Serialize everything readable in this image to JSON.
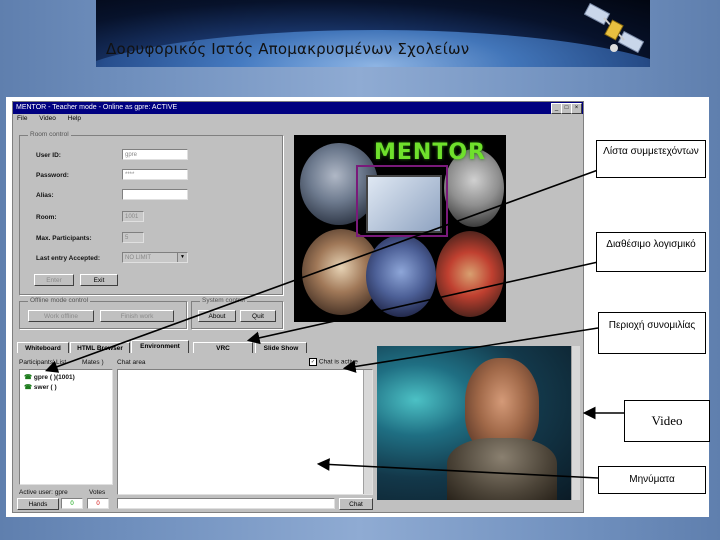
{
  "banner": {
    "title": "Δορυφορικός Ιστός Απομακρυσμένων Σχολείων"
  },
  "window": {
    "title": "MENTOR - Teacher mode - Online as gpre: ACTIVE",
    "buttons": [
      "_",
      "□",
      "×"
    ]
  },
  "menu": [
    "File",
    "Video",
    "Help"
  ],
  "room_control": {
    "group_label": "Room control",
    "fields": [
      {
        "label": "User ID:",
        "value": "gpre"
      },
      {
        "label": "Password:",
        "value": "****"
      },
      {
        "label": "Alias:",
        "value": ""
      },
      {
        "label": "Room:",
        "value": "1001"
      },
      {
        "label": "Max. Participants:",
        "value": "5"
      },
      {
        "label": "Last entry Accepted:",
        "value": "NO LIMIT"
      }
    ],
    "enter_label": "Enter",
    "exit_label": "Exit"
  },
  "offline": {
    "group_label": "Offline mode control",
    "work_offline_label": "Work offline",
    "finish_label": "Finish work"
  },
  "system": {
    "group_label": "System control",
    "about_label": "About",
    "quit_label": "Quit"
  },
  "mentor_image": {
    "logo_text": "MENTOR"
  },
  "tabs": [
    "Whiteboard",
    "HTML Browser",
    "Environment",
    "VRC",
    "Slide Show"
  ],
  "participants": {
    "header": "Participants' List",
    "header_suffix": "Mates )",
    "items": [
      "gpre ( )(1001)",
      "swer ( )"
    ],
    "active_user": "Active user: gpre",
    "votes_label": "Votes",
    "hands_label": "Hands",
    "count_green": "0",
    "count_red": "0"
  },
  "chat": {
    "area_label": "Chat area",
    "checkbox_label": "Chat is active",
    "send_label": "Chat"
  },
  "callouts": {
    "participants_list": "Λίστα συμμετεχόντων",
    "software": "Διαθέσιμο λογισμικό",
    "chat_area": "Περιοχή συνομιλίας",
    "video": "Video",
    "messages": "Μηνύματα"
  },
  "colors": {
    "titlebar": "#000080",
    "mentor_green": "#6fe02c",
    "vote_green": "#00a000",
    "vote_red": "#d00000"
  }
}
